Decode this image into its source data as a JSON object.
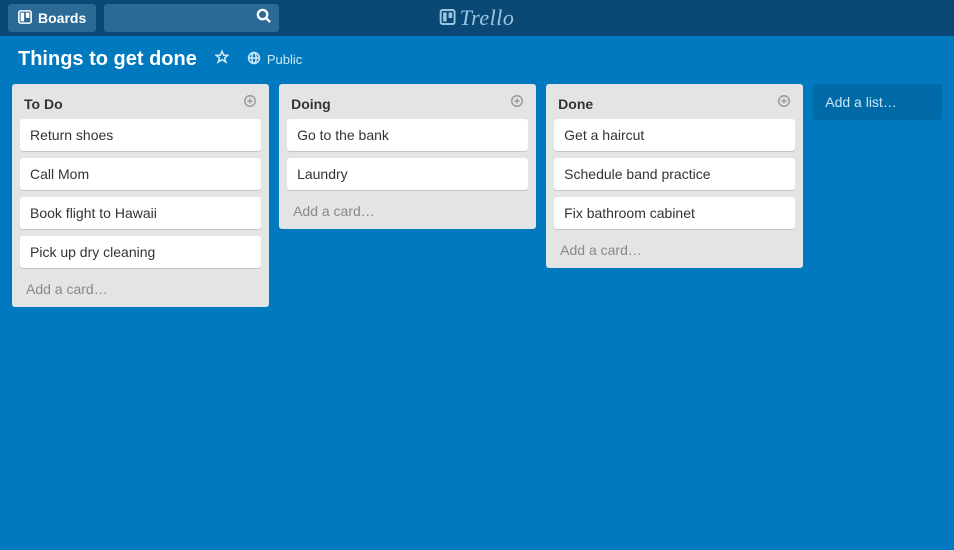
{
  "app": {
    "brand": "Trello",
    "boards_button": "Boards",
    "search_placeholder": ""
  },
  "board": {
    "title": "Things to get done",
    "visibility": "Public",
    "add_list_label": "Add a list…"
  },
  "lists": [
    {
      "title": "To Do",
      "add_card_label": "Add a card…",
      "cards": [
        {
          "text": "Return shoes"
        },
        {
          "text": "Call Mom"
        },
        {
          "text": "Book flight to Hawaii"
        },
        {
          "text": "Pick up dry cleaning"
        }
      ]
    },
    {
      "title": "Doing",
      "add_card_label": "Add a card…",
      "cards": [
        {
          "text": "Go to the bank"
        },
        {
          "text": "Laundry"
        }
      ]
    },
    {
      "title": "Done",
      "add_card_label": "Add a card…",
      "cards": [
        {
          "text": "Get a haircut"
        },
        {
          "text": "Schedule band practice"
        },
        {
          "text": "Fix bathroom cabinet"
        }
      ]
    }
  ]
}
